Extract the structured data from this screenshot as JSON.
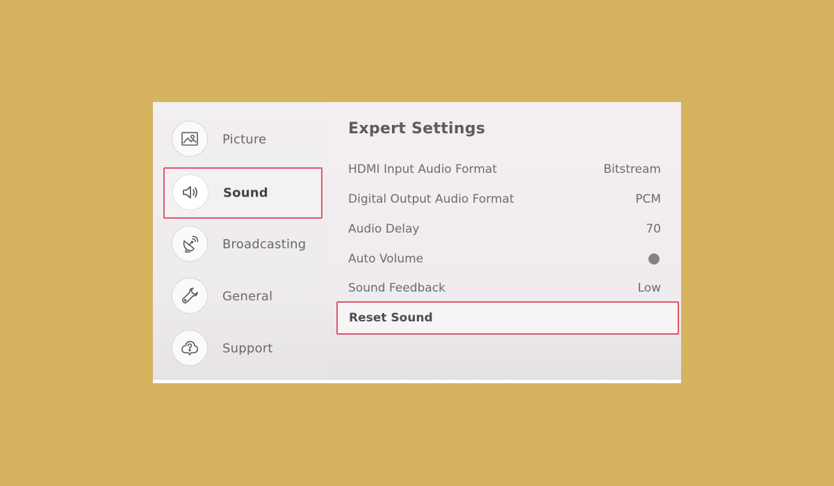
{
  "sidebar": {
    "items": [
      {
        "label": "Picture",
        "icon": "picture-icon"
      },
      {
        "label": "Sound",
        "icon": "speaker-icon",
        "selected": true
      },
      {
        "label": "Broadcasting",
        "icon": "satellite-dish-icon"
      },
      {
        "label": "General",
        "icon": "wrench-icon"
      },
      {
        "label": "Support",
        "icon": "support-cloud-icon"
      }
    ]
  },
  "main": {
    "title": "Expert Settings",
    "settings": [
      {
        "label": "HDMI Input Audio Format",
        "value": "Bitstream"
      },
      {
        "label": "Digital Output Audio Format",
        "value": "PCM"
      },
      {
        "label": "Audio Delay",
        "value": "70"
      },
      {
        "label": "Auto Volume",
        "value_icon": "toggle-off-dot"
      },
      {
        "label": "Sound Feedback",
        "value": "Low"
      }
    ],
    "reset_label": "Reset Sound"
  },
  "colors": {
    "background": "#d5b35f",
    "highlight_border": "#e0536b"
  }
}
